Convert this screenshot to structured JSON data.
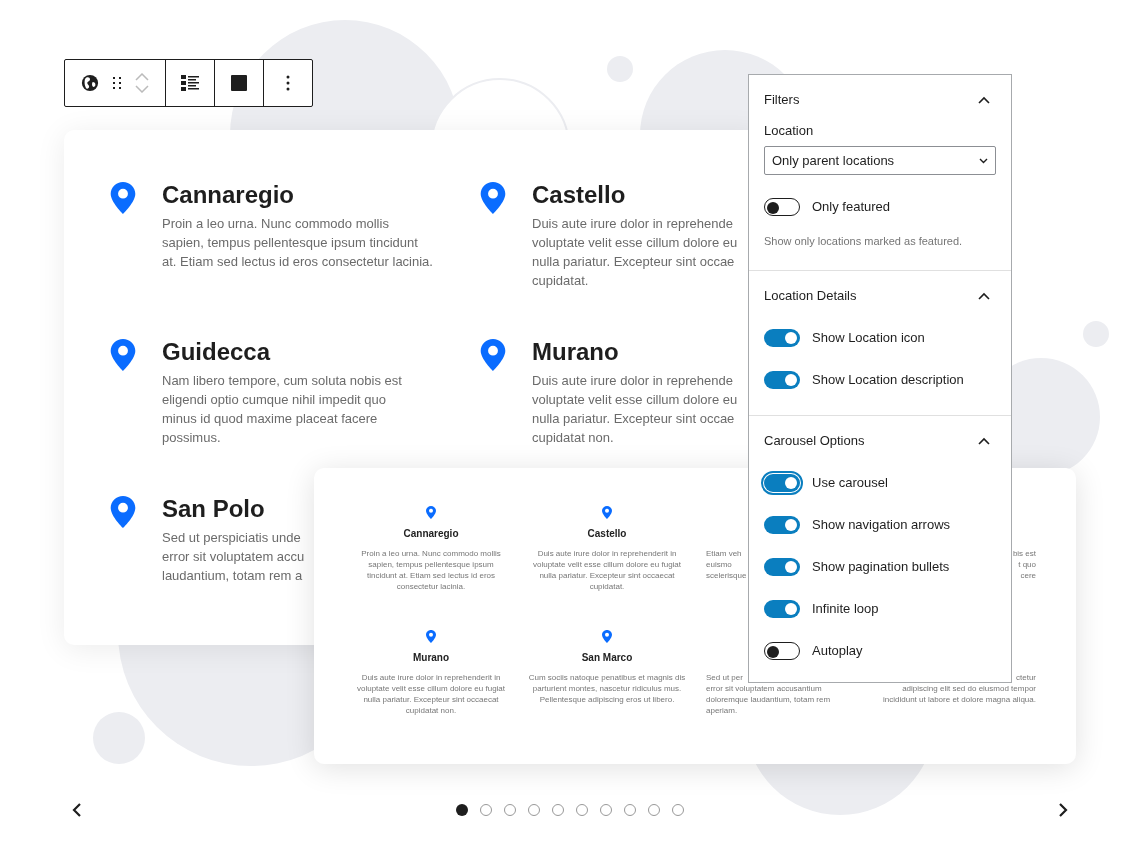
{
  "locations_grid": {
    "items": [
      {
        "title": "Cannaregio",
        "lines": [
          "Proin a leo urna. Nunc commodo mollis",
          "sapien, tempus pellentesque ipsum tincidunt",
          "at. Etiam sed lectus id eros consectetur lacinia."
        ]
      },
      {
        "title": "Castello",
        "lines": [
          "Duis aute irure dolor in reprehende",
          "voluptate velit esse cillum dolore eu",
          "nulla pariatur. Excepteur sint occae",
          "cupidatat."
        ]
      },
      {
        "title": "Guidecca",
        "lines": [
          "Nam libero tempore, cum soluta nobis est",
          "eligendi optio cumque nihil impedit quo",
          "minus id quod maxime placeat facere",
          "possimus."
        ]
      },
      {
        "title": "Murano",
        "lines": [
          "Duis aute irure dolor in reprehende",
          "voluptate velit esse cillum dolore eu",
          "nulla pariatur. Excepteur sint occae",
          "cupidatat non."
        ]
      },
      {
        "title": "San Polo",
        "lines": [
          "Sed ut perspiciatis unde",
          "error sit voluptatem accu",
          "laudantium, totam rem a"
        ]
      }
    ]
  },
  "carousel_preview": {
    "items": [
      {
        "title": "Cannaregio",
        "lines": [
          "Proin a leo urna. Nunc commodo mollis",
          "sapien, tempus pellentesque ipsum",
          "tincidunt at. Etiam sed lectus id eros",
          "consectetur lacinia."
        ]
      },
      {
        "title": "Castello",
        "lines": [
          "Duis aute irure dolor in reprehenderit in",
          "voluptate velit esse cillum dolore eu fugiat",
          "nulla pariatur. Excepteur sint occaecat",
          "cupidatat."
        ]
      },
      {
        "lines": [
          "Etiam veh",
          "euismo",
          "scelerisque"
        ]
      },
      {
        "lines": [
          "bis est",
          "t quo",
          "cere"
        ]
      },
      {
        "title": "Murano",
        "lines": [
          "Duis aute irure dolor in reprehenderit in",
          "voluptate velit esse cillum dolore eu fugiat",
          "nulla pariatur. Excepteur sint occaecat",
          "cupidatat non."
        ]
      },
      {
        "title": "San Marco",
        "lines": [
          "Cum sociis natoque penatibus et magnis dis",
          "parturient montes, nascetur ridiculus mus.",
          "Pellentesque adipiscing eros ut libero."
        ]
      },
      {
        "lines": [
          "Sed ut per",
          "error sit voluptatem accusantium",
          "doloremque laudantium, totam rem",
          "aperiam."
        ]
      },
      {
        "lines": [
          "ctetur",
          "adipiscing elit sed do eiusmod tempor",
          "incididunt ut labore et dolore magna aliqua."
        ]
      }
    ]
  },
  "settings_panel": {
    "sections": [
      {
        "title": "Filters",
        "expanded": true,
        "controls": [
          {
            "kind": "select",
            "label": "Location",
            "value": "Only parent locations"
          },
          {
            "kind": "toggle",
            "label": "Only featured",
            "on": false,
            "focused": false
          },
          {
            "kind": "help",
            "text": "Show only locations marked as featured."
          }
        ]
      },
      {
        "title": "Location Details",
        "expanded": true,
        "controls": [
          {
            "kind": "toggle",
            "label": "Show Location icon",
            "on": true,
            "focused": false
          },
          {
            "kind": "toggle",
            "label": "Show Location description",
            "on": true,
            "focused": false
          }
        ]
      },
      {
        "title": "Carousel Options",
        "expanded": true,
        "controls": [
          {
            "kind": "toggle",
            "label": "Use carousel",
            "on": true,
            "focused": true
          },
          {
            "kind": "toggle",
            "label": "Show navigation arrows",
            "on": true,
            "focused": false
          },
          {
            "kind": "toggle",
            "label": "Show pagination bullets",
            "on": true,
            "focused": false
          },
          {
            "kind": "toggle",
            "label": "Infinite loop",
            "on": true,
            "focused": false
          },
          {
            "kind": "toggle",
            "label": "Autoplay",
            "on": false,
            "focused": false
          }
        ]
      }
    ]
  },
  "pagination": {
    "bullets": [
      {
        "selected": true
      },
      {
        "selected": false
      },
      {
        "selected": false
      },
      {
        "selected": false
      },
      {
        "selected": false
      },
      {
        "selected": false
      },
      {
        "selected": false
      },
      {
        "selected": false
      },
      {
        "selected": false
      },
      {
        "selected": false
      }
    ]
  }
}
